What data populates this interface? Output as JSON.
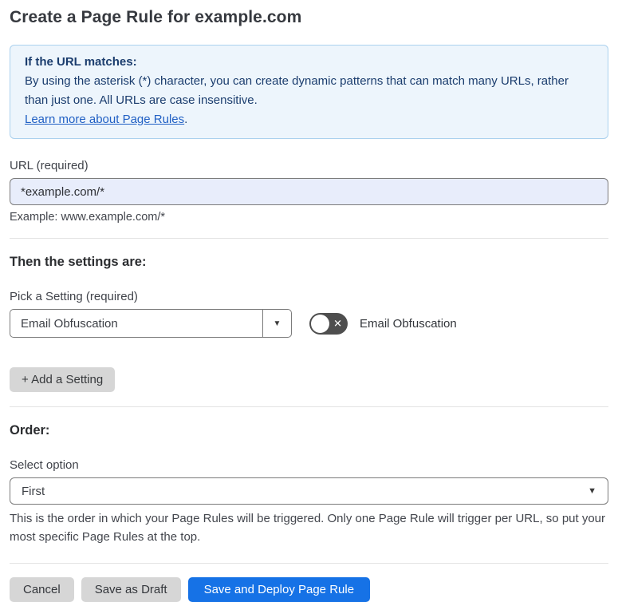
{
  "page": {
    "title": "Create a Page Rule for example.com"
  },
  "info_box": {
    "heading": "If the URL matches:",
    "body": "By using the asterisk (*) character, you can create dynamic patterns that can match many URLs, rather than just one. All URLs are case insensitive.",
    "link_text": "Learn more about Page Rules",
    "link_suffix": "."
  },
  "url_field": {
    "label": "URL (required)",
    "value": "*example.com/*",
    "example": "Example: www.example.com/*"
  },
  "settings_section": {
    "heading": "Then the settings are:",
    "pick_label": "Pick a Setting (required)",
    "selected_setting": "Email Obfuscation",
    "toggle_state": "off",
    "toggle_label": "Email Obfuscation",
    "add_button_label": "+ Add a Setting"
  },
  "order_section": {
    "heading": "Order:",
    "select_label": "Select option",
    "selected_option": "First",
    "help": "This is the order in which your Page Rules will be triggered. Only one Page Rule will trigger per URL, so put your most specific Page Rules at the top."
  },
  "footer": {
    "cancel_label": "Cancel",
    "save_draft_label": "Save as Draft",
    "save_deploy_label": "Save and Deploy Page Rule"
  },
  "icons": {
    "caret_down": "▼",
    "toggle_off_x": "✕"
  },
  "colors": {
    "info_box_bg": "#edf5fc",
    "info_box_border": "#abd1ee",
    "info_text": "#1b3d6e",
    "link_blue": "#2160c4",
    "input_bg": "#e8edfb",
    "toggle_track": "#4e4e4e",
    "primary_button": "#1672e6",
    "gray_button": "#d6d6d6"
  }
}
